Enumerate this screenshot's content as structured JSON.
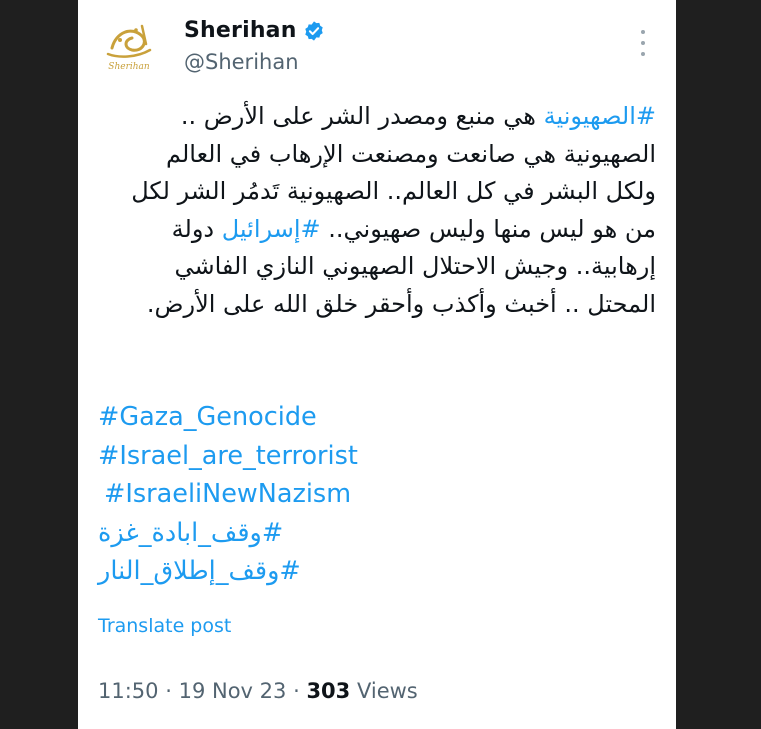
{
  "author": {
    "display_name": "Sherihan",
    "handle": "@Sherihan",
    "verified": true,
    "logo_text": "Sherihan",
    "avatar_icon": "gold-calligraphy-logo"
  },
  "post": {
    "lines": [
      {
        "tag": "#الصهيونية",
        "rest": " هي منبع ومصدر الشر على الأرض .."
      },
      {
        "text": "الصهيونية هي صانعت ومصنعت الإرهاب في العالم"
      },
      {
        "text": "ولكل البشر في كل العالم.. الصهيونية تَدمُر الشر لكل"
      },
      {
        "before": "من هو ليس منها وليس صهيوني.. ",
        "tag": "#إسرائيل",
        "after": " دولة"
      },
      {
        "text": "إرهابية.. وجيش الاحتلال الصهيوني النازي الفاشي"
      },
      {
        "text": "المحتل .. أخبث وأكذب وأحقر خلق الله على الأرض."
      }
    ],
    "hashtags": [
      "#Gaza_Genocide",
      "#Israel_are_terrorist",
      "#IsraeliNewNazism",
      "#وقف_ابادة_غزة",
      "#وقف_إطلاق_النار"
    ],
    "translate_label": "Translate post"
  },
  "meta": {
    "time": "11:50",
    "separator": "·",
    "date": "19 Nov 23",
    "views_count": "303",
    "views_label": "Views"
  },
  "colors": {
    "link": "#1d9bf0",
    "text": "#0f1419",
    "secondary": "#536471",
    "verified": "#1d9bf0",
    "logo_gold": "#c9a13b",
    "frame": "#1f1f1f"
  }
}
